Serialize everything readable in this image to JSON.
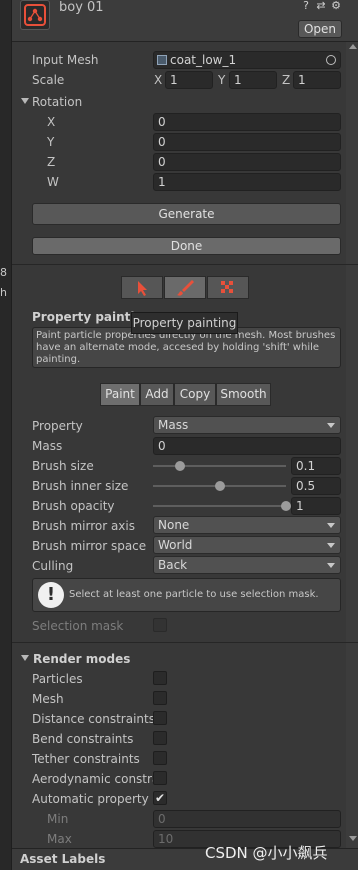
{
  "header": {
    "title": "boy 01",
    "open_label": "Open",
    "icons": [
      "help-icon",
      "preset-icon",
      "settings-icon"
    ]
  },
  "fields": {
    "input_mesh": {
      "label": "Input Mesh",
      "value": "coat_low_1"
    },
    "scale": {
      "label": "Scale",
      "x_label": "X",
      "x": "1",
      "y_label": "Y",
      "y": "1",
      "z_label": "Z",
      "z": "1"
    },
    "rotation": {
      "label": "Rotation",
      "x_label": "X",
      "x": "0",
      "y_label": "Y",
      "y": "0",
      "z_label": "Z",
      "z": "0",
      "w_label": "W",
      "w": "1"
    }
  },
  "buttons": {
    "generate": "Generate",
    "done": "Done"
  },
  "tools": {
    "active": "paint",
    "tooltip": "Property painting"
  },
  "painting": {
    "heading": "Property painting",
    "help_text": "Paint particle properties directly on the mesh. Most brushes have an alternate mode, accesed by holding 'shift' while painting.",
    "tabs": [
      "Paint",
      "Add",
      "Copy",
      "Smooth"
    ],
    "selected_tab": "Paint",
    "property": {
      "label": "Property",
      "value": "Mass"
    },
    "mass": {
      "label": "Mass",
      "value": "0"
    },
    "brush_size": {
      "label": "Brush size",
      "value": "0.1",
      "fraction": 0.2
    },
    "brush_inner_size": {
      "label": "Brush inner size",
      "value": "0.5",
      "fraction": 0.5
    },
    "brush_opacity": {
      "label": "Brush opacity",
      "value": "1",
      "fraction": 1.0
    },
    "brush_mirror_axis": {
      "label": "Brush mirror axis",
      "value": "None"
    },
    "brush_mirror_space": {
      "label": "Brush mirror space",
      "value": "World"
    },
    "culling": {
      "label": "Culling",
      "value": "Back"
    },
    "info": "Select at least one particle to use selection mask.",
    "selection_mask": {
      "label": "Selection mask",
      "checked": false
    }
  },
  "render_modes": {
    "heading": "Render modes",
    "items": [
      {
        "label": "Particles",
        "checked": false
      },
      {
        "label": "Mesh",
        "checked": false
      },
      {
        "label": "Distance constraints",
        "checked": false
      },
      {
        "label": "Bend constraints",
        "checked": false
      },
      {
        "label": "Tether constraints",
        "checked": false
      },
      {
        "label": "Aerodynamic constra",
        "checked": false
      },
      {
        "label": "Automatic property ra",
        "checked": true
      }
    ],
    "min": {
      "label": "Min",
      "value": "0"
    },
    "max": {
      "label": "Max",
      "value": "10"
    }
  },
  "footer": {
    "asset_labels": "Asset Labels"
  },
  "watermark": "CSDN @小小飙兵",
  "left_strip": {
    "a": "8",
    "b": "h"
  },
  "colors": {
    "accent_red": "#e8503a",
    "background": "#383838",
    "field": "#2a2a2a"
  }
}
